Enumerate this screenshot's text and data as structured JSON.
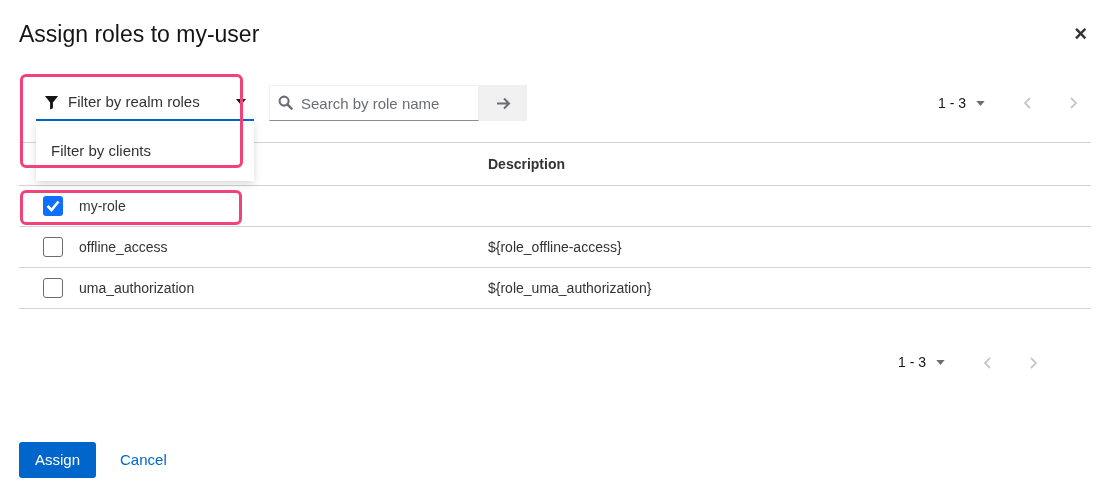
{
  "dialog": {
    "title": "Assign roles to my-user",
    "close": "×"
  },
  "toolbar": {
    "filter": {
      "label": "Filter by realm roles",
      "expanded": true,
      "options": [
        "Filter by clients"
      ]
    },
    "search": {
      "placeholder": "Search by role name"
    },
    "pagination": {
      "range": "1 - 3",
      "prev_disabled": true,
      "next_disabled": true
    }
  },
  "table": {
    "columns": [
      "Description"
    ],
    "rows": [
      {
        "name": "my-role",
        "description": "",
        "selected": true
      },
      {
        "name": "offline_access",
        "description": "${role_offline-access}",
        "selected": false
      },
      {
        "name": "uma_authorization",
        "description": "${role_uma_authorization}",
        "selected": false
      }
    ]
  },
  "bottom_pagination": {
    "range": "1 - 3",
    "prev_disabled": true,
    "next_disabled": true
  },
  "buttons": [
    {
      "label": "Assign",
      "kind": "primary"
    },
    {
      "label": "Cancel",
      "kind": "link"
    }
  ]
}
